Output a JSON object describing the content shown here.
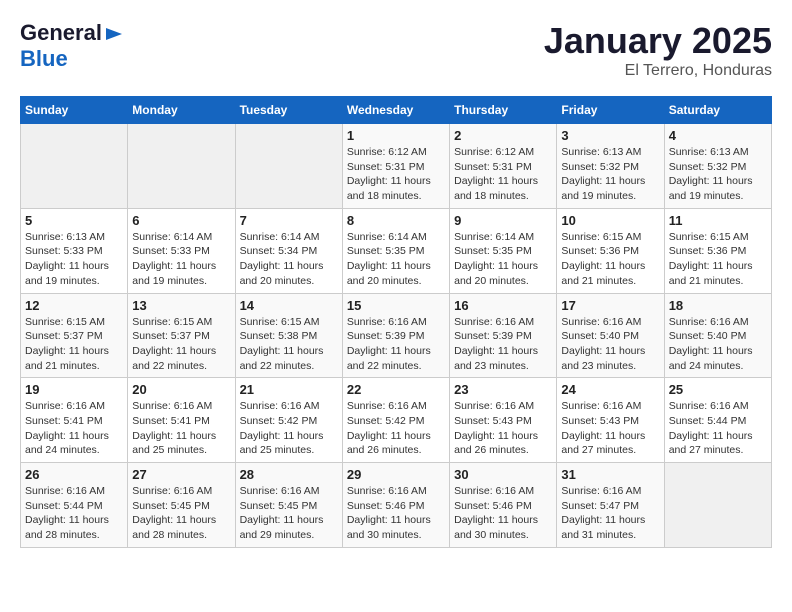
{
  "logo": {
    "line1": "General",
    "line2": "Blue"
  },
  "title": "January 2025",
  "subtitle": "El Terrero, Honduras",
  "days_of_week": [
    "Sunday",
    "Monday",
    "Tuesday",
    "Wednesday",
    "Thursday",
    "Friday",
    "Saturday"
  ],
  "weeks": [
    [
      {
        "day": "",
        "info": ""
      },
      {
        "day": "",
        "info": ""
      },
      {
        "day": "",
        "info": ""
      },
      {
        "day": "1",
        "info": "Sunrise: 6:12 AM\nSunset: 5:31 PM\nDaylight: 11 hours and 18 minutes."
      },
      {
        "day": "2",
        "info": "Sunrise: 6:12 AM\nSunset: 5:31 PM\nDaylight: 11 hours and 18 minutes."
      },
      {
        "day": "3",
        "info": "Sunrise: 6:13 AM\nSunset: 5:32 PM\nDaylight: 11 hours and 19 minutes."
      },
      {
        "day": "4",
        "info": "Sunrise: 6:13 AM\nSunset: 5:32 PM\nDaylight: 11 hours and 19 minutes."
      }
    ],
    [
      {
        "day": "5",
        "info": "Sunrise: 6:13 AM\nSunset: 5:33 PM\nDaylight: 11 hours and 19 minutes."
      },
      {
        "day": "6",
        "info": "Sunrise: 6:14 AM\nSunset: 5:33 PM\nDaylight: 11 hours and 19 minutes."
      },
      {
        "day": "7",
        "info": "Sunrise: 6:14 AM\nSunset: 5:34 PM\nDaylight: 11 hours and 20 minutes."
      },
      {
        "day": "8",
        "info": "Sunrise: 6:14 AM\nSunset: 5:35 PM\nDaylight: 11 hours and 20 minutes."
      },
      {
        "day": "9",
        "info": "Sunrise: 6:14 AM\nSunset: 5:35 PM\nDaylight: 11 hours and 20 minutes."
      },
      {
        "day": "10",
        "info": "Sunrise: 6:15 AM\nSunset: 5:36 PM\nDaylight: 11 hours and 21 minutes."
      },
      {
        "day": "11",
        "info": "Sunrise: 6:15 AM\nSunset: 5:36 PM\nDaylight: 11 hours and 21 minutes."
      }
    ],
    [
      {
        "day": "12",
        "info": "Sunrise: 6:15 AM\nSunset: 5:37 PM\nDaylight: 11 hours and 21 minutes."
      },
      {
        "day": "13",
        "info": "Sunrise: 6:15 AM\nSunset: 5:37 PM\nDaylight: 11 hours and 22 minutes."
      },
      {
        "day": "14",
        "info": "Sunrise: 6:15 AM\nSunset: 5:38 PM\nDaylight: 11 hours and 22 minutes."
      },
      {
        "day": "15",
        "info": "Sunrise: 6:16 AM\nSunset: 5:39 PM\nDaylight: 11 hours and 22 minutes."
      },
      {
        "day": "16",
        "info": "Sunrise: 6:16 AM\nSunset: 5:39 PM\nDaylight: 11 hours and 23 minutes."
      },
      {
        "day": "17",
        "info": "Sunrise: 6:16 AM\nSunset: 5:40 PM\nDaylight: 11 hours and 23 minutes."
      },
      {
        "day": "18",
        "info": "Sunrise: 6:16 AM\nSunset: 5:40 PM\nDaylight: 11 hours and 24 minutes."
      }
    ],
    [
      {
        "day": "19",
        "info": "Sunrise: 6:16 AM\nSunset: 5:41 PM\nDaylight: 11 hours and 24 minutes."
      },
      {
        "day": "20",
        "info": "Sunrise: 6:16 AM\nSunset: 5:41 PM\nDaylight: 11 hours and 25 minutes."
      },
      {
        "day": "21",
        "info": "Sunrise: 6:16 AM\nSunset: 5:42 PM\nDaylight: 11 hours and 25 minutes."
      },
      {
        "day": "22",
        "info": "Sunrise: 6:16 AM\nSunset: 5:42 PM\nDaylight: 11 hours and 26 minutes."
      },
      {
        "day": "23",
        "info": "Sunrise: 6:16 AM\nSunset: 5:43 PM\nDaylight: 11 hours and 26 minutes."
      },
      {
        "day": "24",
        "info": "Sunrise: 6:16 AM\nSunset: 5:43 PM\nDaylight: 11 hours and 27 minutes."
      },
      {
        "day": "25",
        "info": "Sunrise: 6:16 AM\nSunset: 5:44 PM\nDaylight: 11 hours and 27 minutes."
      }
    ],
    [
      {
        "day": "26",
        "info": "Sunrise: 6:16 AM\nSunset: 5:44 PM\nDaylight: 11 hours and 28 minutes."
      },
      {
        "day": "27",
        "info": "Sunrise: 6:16 AM\nSunset: 5:45 PM\nDaylight: 11 hours and 28 minutes."
      },
      {
        "day": "28",
        "info": "Sunrise: 6:16 AM\nSunset: 5:45 PM\nDaylight: 11 hours and 29 minutes."
      },
      {
        "day": "29",
        "info": "Sunrise: 6:16 AM\nSunset: 5:46 PM\nDaylight: 11 hours and 30 minutes."
      },
      {
        "day": "30",
        "info": "Sunrise: 6:16 AM\nSunset: 5:46 PM\nDaylight: 11 hours and 30 minutes."
      },
      {
        "day": "31",
        "info": "Sunrise: 6:16 AM\nSunset: 5:47 PM\nDaylight: 11 hours and 31 minutes."
      },
      {
        "day": "",
        "info": ""
      }
    ]
  ]
}
